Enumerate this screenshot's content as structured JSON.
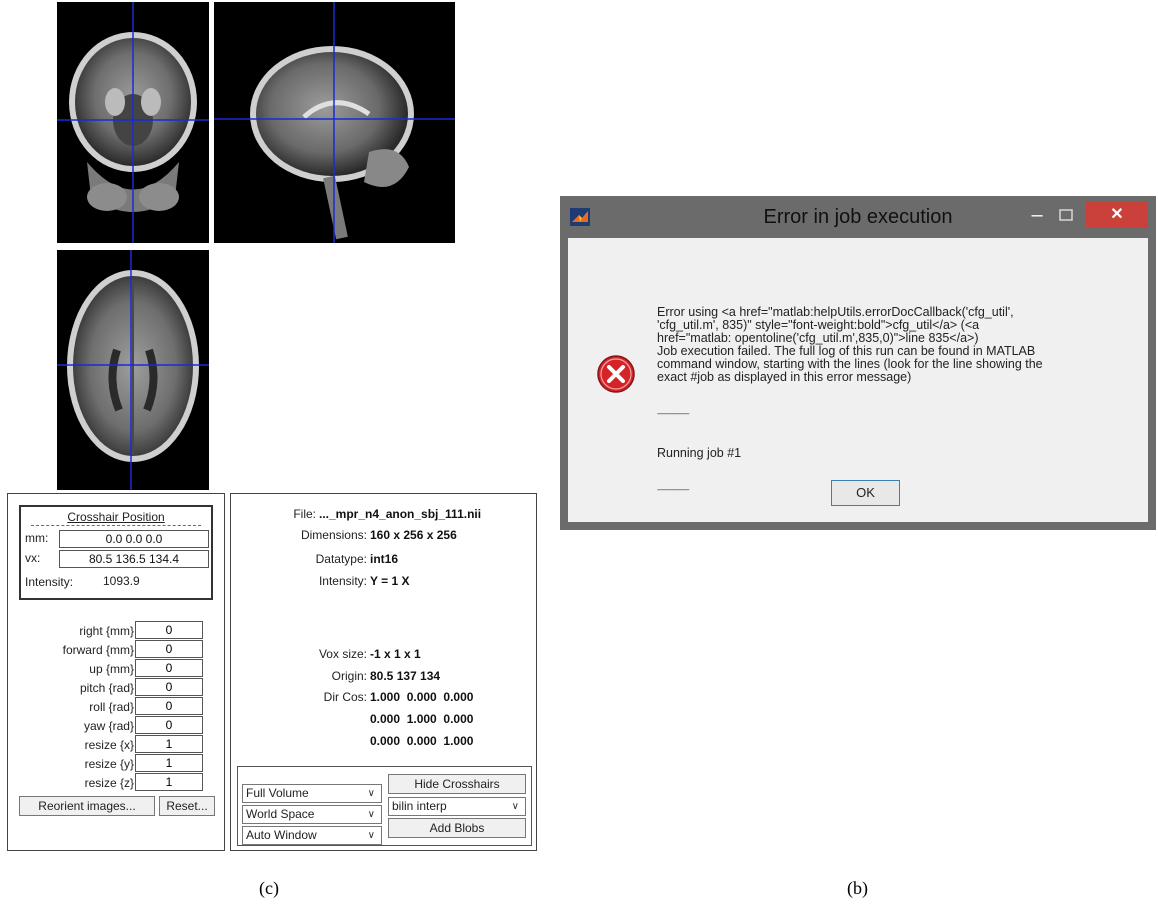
{
  "slice_panes": {
    "coronal": "coronal slice",
    "sagittal": "sagittal slice",
    "axial": "axial slice",
    "crosshair_color": "#1a2bd6"
  },
  "crosshair_position": {
    "title": "Crosshair Position",
    "mm_label": "mm:",
    "mm_value": "0.0 0.0 0.0",
    "vx_label": "vx:",
    "vx_value": "80.5 136.5 134.4",
    "intensity_label": "Intensity:",
    "intensity_value": "1093.9"
  },
  "params": [
    {
      "label": "right  {mm}",
      "value": "0"
    },
    {
      "label": "forward  {mm}",
      "value": "0"
    },
    {
      "label": "up  {mm}",
      "value": "0"
    },
    {
      "label": "pitch  {rad}",
      "value": "0"
    },
    {
      "label": "roll  {rad}",
      "value": "0"
    },
    {
      "label": "yaw  {rad}",
      "value": "0"
    },
    {
      "label": "resize  {x}",
      "value": "1"
    },
    {
      "label": "resize  {y}",
      "value": "1"
    },
    {
      "label": "resize  {z}",
      "value": "1"
    }
  ],
  "buttons": {
    "reorient": "Reorient images...",
    "reset": "Reset...",
    "hide_crosshairs": "Hide Crosshairs",
    "add_blobs": "Add Blobs"
  },
  "file_info": {
    "file_label": "File:",
    "file_value": "..._mpr_n4_anon_sbj_111.nii",
    "dimensions_label": "Dimensions:",
    "dimensions_value": "160 x 256 x 256",
    "datatype_label": "Datatype:",
    "datatype_value": "int16",
    "intensity_label": "Intensity:",
    "intensity_value": "Y = 1 X",
    "voxsize_label": "Vox size:",
    "voxsize_value": "-1 x 1 x 1",
    "origin_label": "Origin:",
    "origin_value": "80.5 137 134",
    "dircos_label": "Dir Cos:",
    "dircos_rows": [
      "1.000  0.000  0.000",
      "0.000  1.000  0.000",
      "0.000  0.000  1.000"
    ]
  },
  "selects": {
    "volume": "Full Volume",
    "space": "World Space",
    "window": "Auto Window",
    "interp": "bilin interp"
  },
  "dialog": {
    "title": "Error in job execution",
    "min_icon": "minimize",
    "max_icon": "maximize",
    "close_icon": "close",
    "app_icon": "matlab-icon",
    "error_icon": "error-icon",
    "message": "Error using <a href=\"matlab:helpUtils.errorDocCallback('cfg_util',\n'cfg_util.m', 835)\" style=\"font-weight:bold\">cfg_util</a> (<a\nhref=\"matlab: opentoline('cfg_util.m',835,0)\">line 835</a>)\nJob execution failed. The full log of this run can be found in MATLAB\ncommand window, starting with the lines (look for the line showing the\nexact #job as displayed in this error message)",
    "separator": "-------------------",
    "running": "Running job #1",
    "ok": "OK"
  },
  "captions": {
    "left": "(c)",
    "right": "(b)"
  }
}
